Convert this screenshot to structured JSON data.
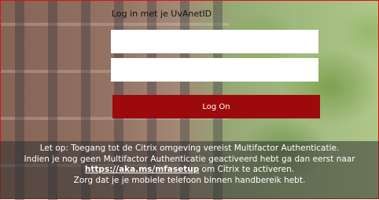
{
  "login": {
    "title": "Log in met je UvAnetID",
    "username_placeholder": "",
    "password_placeholder": "",
    "logon_label": "Log On"
  },
  "notice": {
    "line1": "Let op: Toegang tot de Citrix omgeving vereist Multifactor Authenticatie.",
    "line2": "Indien je nog geen Multifactor Authenticatie geactiveerd hebt ga dan eerst naar",
    "link": "https://aka.ms/mfasetup",
    "line3_after": " om Citrix te activeren.",
    "line4": "Zorg dat je je mobiele telefoon binnen handbereik hebt."
  },
  "colors": {
    "button": "#9d0a0e",
    "border": "#d40000"
  }
}
